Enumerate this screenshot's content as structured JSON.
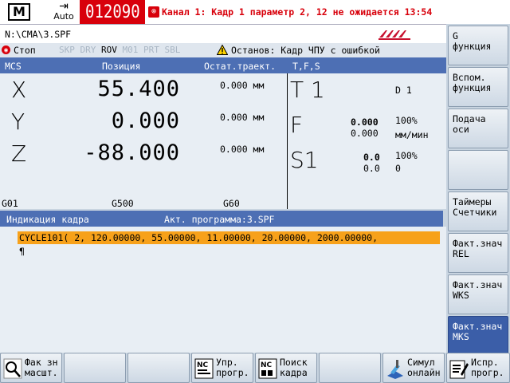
{
  "top": {
    "mode_letter": "M",
    "auto_label": "Auto",
    "alarm_number": "012090",
    "alarm_text": "Канал 1: Кадр 1 параметр 2, 12 не ожидается 13:54"
  },
  "path": "N:\\CMA\\3.SPF",
  "status": {
    "stop": "Стоп",
    "flags": [
      "SKP",
      "DRY",
      "ROV",
      "M01",
      "PRT",
      "SBL"
    ],
    "active_flag": "ROV",
    "warning": "Останов: Кадр ЧПУ с ошибкой"
  },
  "positions": {
    "headers": {
      "mcs": "MCS",
      "position": "Позиция",
      "dtg": "Остат.траект.",
      "tfs": "T,F,S"
    },
    "axes": [
      {
        "name": "X",
        "value": "55.400",
        "dtg": "0.000 мм"
      },
      {
        "name": "Y",
        "value": "0.000",
        "dtg": "0.000 мм"
      },
      {
        "name": "Z",
        "value": "-88.000",
        "dtg": "0.000 мм"
      }
    ],
    "tool": {
      "label": "T 1",
      "d": "D  1"
    },
    "feed": {
      "label": "F",
      "actual": "0.000",
      "set": "0.000",
      "override": "100%",
      "unit": "мм/мин"
    },
    "spindle": {
      "label": "S1",
      "actual": "0.0",
      "set": "0.0",
      "override": "100%",
      "extra": "0"
    },
    "gcodes": [
      "G01",
      "G500",
      "G60"
    ]
  },
  "block": {
    "title": "Индикация кадра",
    "program": "Акт. программа:3.SPF",
    "current": "CYCLE101( 2, 120.00000, 55.00000, 11.00000, 20.00000, 2000.00000,",
    "next": "¶"
  },
  "right_keys": [
    {
      "label": "G\nфункция"
    },
    {
      "label": "Вспом.\nфункция"
    },
    {
      "label": "Подача\nоси"
    },
    {
      "label": ""
    },
    {
      "label": "Таймеры\nСчетчики"
    },
    {
      "label": "Факт.знач\nREL"
    },
    {
      "label": "Факт.знач\nWKS"
    },
    {
      "label": "Факт.знач\nMKS"
    }
  ],
  "bottom_keys": [
    {
      "label": "Фак зн\nмасшт."
    },
    {
      "label": ""
    },
    {
      "label": ""
    },
    {
      "label": "Упр.\nпрогр."
    },
    {
      "label": "Поиск\nкадра"
    },
    {
      "label": ""
    },
    {
      "label": "Симул\nонлайн"
    },
    {
      "label": "Испр.\nпрогр."
    }
  ],
  "colors": {
    "header_blue": "#4d6fb4",
    "alarm_red": "#d8000b",
    "highlight_orange": "#f7a11a"
  }
}
